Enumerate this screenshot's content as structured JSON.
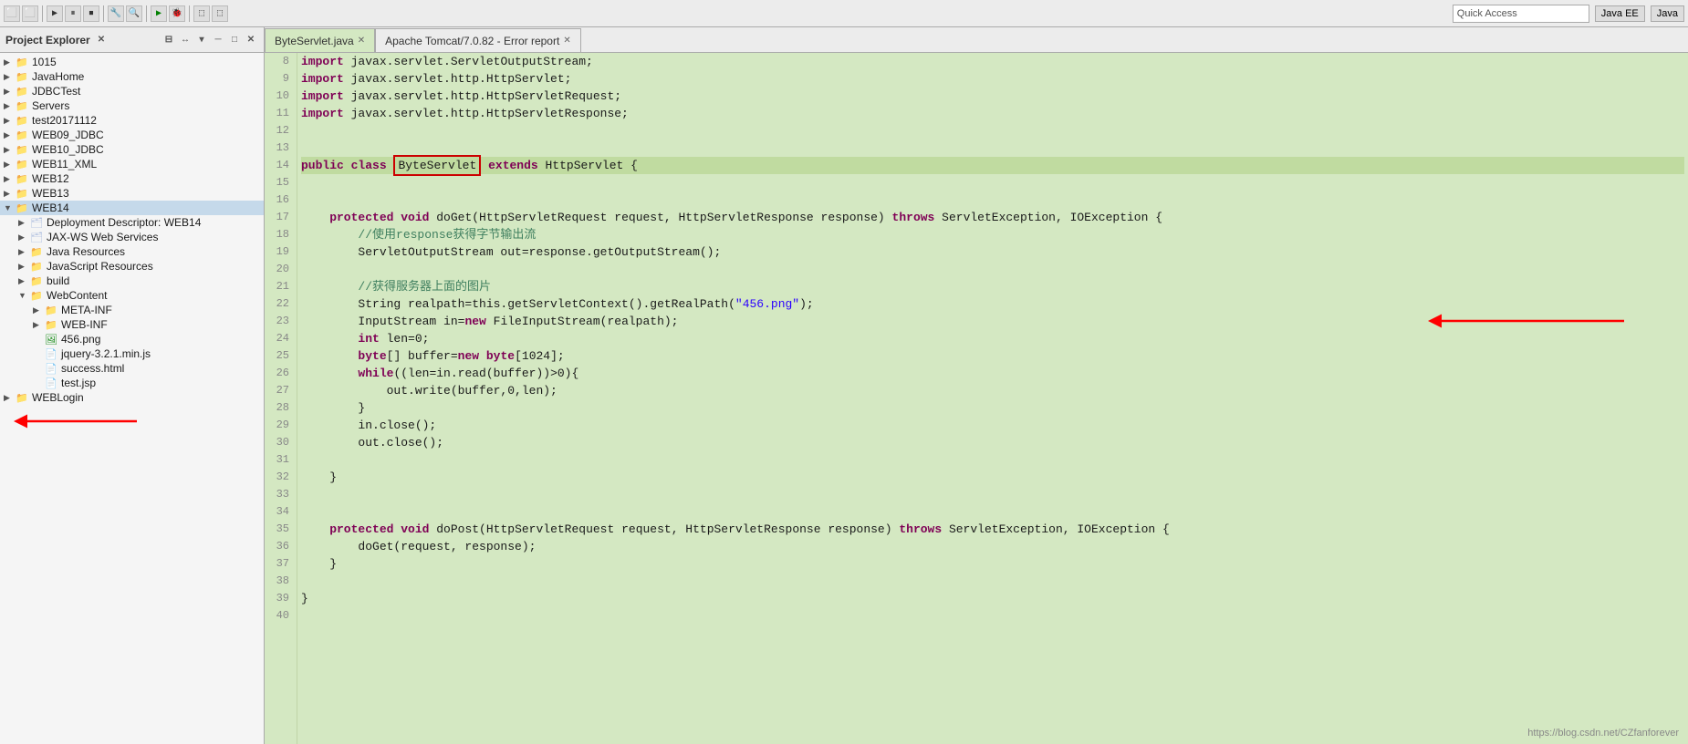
{
  "toolbar": {
    "quick_access_placeholder": "Quick Access",
    "perspective1": "Java EE",
    "perspective2": "Java"
  },
  "left_panel": {
    "title": "Project Explorer",
    "close_icon": "✕",
    "tree_items": [
      {
        "id": "1015",
        "label": "1015",
        "indent": 0,
        "arrow": "▶",
        "type": "project"
      },
      {
        "id": "JavaHome",
        "label": "JavaHome",
        "indent": 0,
        "arrow": "▶",
        "type": "project"
      },
      {
        "id": "JDBCTest",
        "label": "JDBCTest",
        "indent": 0,
        "arrow": "▶",
        "type": "project"
      },
      {
        "id": "Servers",
        "label": "Servers",
        "indent": 0,
        "arrow": "▶",
        "type": "project"
      },
      {
        "id": "test20171112",
        "label": "test20171112",
        "indent": 0,
        "arrow": "▶",
        "type": "project"
      },
      {
        "id": "WEB09_JDBC",
        "label": "WEB09_JDBC",
        "indent": 0,
        "arrow": "▶",
        "type": "project"
      },
      {
        "id": "WEB10_JDBC",
        "label": "WEB10_JDBC",
        "indent": 0,
        "arrow": "▶",
        "type": "project"
      },
      {
        "id": "WEB11_XML",
        "label": "WEB11_XML",
        "indent": 0,
        "arrow": "▶",
        "type": "project"
      },
      {
        "id": "WEB12",
        "label": "WEB12",
        "indent": 0,
        "arrow": "▶",
        "type": "project"
      },
      {
        "id": "WEB13",
        "label": "WEB13",
        "indent": 0,
        "arrow": "▶",
        "type": "project"
      },
      {
        "id": "WEB14",
        "label": "WEB14",
        "indent": 0,
        "arrow": "▼",
        "type": "project",
        "selected": true
      },
      {
        "id": "DeploymentDescriptor",
        "label": "Deployment Descriptor: WEB14",
        "indent": 1,
        "arrow": "▶",
        "type": "xml"
      },
      {
        "id": "JAXWSWebServices",
        "label": "JAX-WS Web Services",
        "indent": 1,
        "arrow": "▶",
        "type": "xml"
      },
      {
        "id": "JavaResources",
        "label": "Java Resources",
        "indent": 1,
        "arrow": "▶",
        "type": "folder"
      },
      {
        "id": "JavaScriptResources",
        "label": "JavaScript Resources",
        "indent": 1,
        "arrow": "▶",
        "type": "folder"
      },
      {
        "id": "build",
        "label": "build",
        "indent": 1,
        "arrow": "▶",
        "type": "folder"
      },
      {
        "id": "WebContent",
        "label": "WebContent",
        "indent": 1,
        "arrow": "▼",
        "type": "folder"
      },
      {
        "id": "META-INF",
        "label": "META-INF",
        "indent": 2,
        "arrow": "▶",
        "type": "folder"
      },
      {
        "id": "WEB-INF",
        "label": "WEB-INF",
        "indent": 2,
        "arrow": "▶",
        "type": "folder"
      },
      {
        "id": "456png",
        "label": "456.png",
        "indent": 2,
        "arrow": "",
        "type": "png"
      },
      {
        "id": "jquery",
        "label": "jquery-3.2.1.min.js",
        "indent": 2,
        "arrow": "",
        "type": "js"
      },
      {
        "id": "successhtml",
        "label": "success.html",
        "indent": 2,
        "arrow": "",
        "type": "html"
      },
      {
        "id": "testjsp",
        "label": "test.jsp",
        "indent": 2,
        "arrow": "",
        "type": "html"
      },
      {
        "id": "WEBLogin",
        "label": "WEBLogin",
        "indent": 0,
        "arrow": "▶",
        "type": "project"
      }
    ]
  },
  "editor": {
    "active_tab": "ByteServlet.java",
    "inactive_tab": "Apache Tomcat/7.0.82 - Error report",
    "lines": [
      {
        "num": 8,
        "content": "import javax.servlet.ServletOutputStream;",
        "tokens": [
          {
            "t": "kw",
            "v": "import"
          },
          {
            "t": "normal",
            "v": " javax.servlet.ServletOutputStream;"
          }
        ]
      },
      {
        "num": 9,
        "content": "import javax.servlet.http.HttpServlet;",
        "tokens": [
          {
            "t": "kw",
            "v": "import"
          },
          {
            "t": "normal",
            "v": " javax.servlet.http.HttpServlet;"
          }
        ]
      },
      {
        "num": 10,
        "content": "import javax.servlet.http.HttpServletRequest;",
        "tokens": [
          {
            "t": "kw",
            "v": "import"
          },
          {
            "t": "normal",
            "v": " javax.servlet.http.HttpServletRequest;"
          }
        ]
      },
      {
        "num": 11,
        "content": "import javax.servlet.http.HttpServletResponse;",
        "tokens": [
          {
            "t": "kw",
            "v": "import"
          },
          {
            "t": "normal",
            "v": " javax.servlet.http.HttpServletResponse;"
          }
        ]
      },
      {
        "num": 12,
        "content": "",
        "tokens": []
      },
      {
        "num": 13,
        "content": "",
        "tokens": []
      },
      {
        "num": 14,
        "content": "public class ByteServlet extends HttpServlet {",
        "tokens": [
          {
            "t": "kw",
            "v": "public"
          },
          {
            "t": "normal",
            "v": " "
          },
          {
            "t": "kw",
            "v": "class"
          },
          {
            "t": "normal",
            "v": " "
          },
          {
            "t": "classname-boxed",
            "v": "ByteServlet"
          },
          {
            "t": "normal",
            "v": " "
          },
          {
            "t": "kw",
            "v": "extends"
          },
          {
            "t": "normal",
            "v": " HttpServlet {"
          }
        ],
        "active": true
      },
      {
        "num": 15,
        "content": "",
        "tokens": []
      },
      {
        "num": 16,
        "content": "",
        "tokens": []
      },
      {
        "num": 17,
        "content": "    protected void doGet(HttpServletRequest request, HttpServletResponse response) throws ServletException, IOException {",
        "tokens": [
          {
            "t": "kw",
            "v": "    protected"
          },
          {
            "t": "normal",
            "v": " "
          },
          {
            "t": "kw",
            "v": "void"
          },
          {
            "t": "normal",
            "v": " doGet(HttpServletRequest request, HttpServletResponse response) "
          },
          {
            "t": "kw",
            "v": "throws"
          },
          {
            "t": "normal",
            "v": " ServletException, IOException {"
          }
        ]
      },
      {
        "num": 18,
        "content": "        //使用response获得字节输出流",
        "tokens": [
          {
            "t": "comment",
            "v": "        //使用response获得字节输出流"
          }
        ]
      },
      {
        "num": 19,
        "content": "        ServletOutputStream out=response.getOutputStream();",
        "tokens": [
          {
            "t": "normal",
            "v": "        ServletOutputStream out=response.getOutputStream();"
          }
        ]
      },
      {
        "num": 20,
        "content": "",
        "tokens": []
      },
      {
        "num": 21,
        "content": "        //获得服务器上面的图片",
        "tokens": [
          {
            "t": "comment",
            "v": "        //获得服务器上面的图片"
          }
        ]
      },
      {
        "num": 22,
        "content": "        String realpath=this.getServletContext().getRealPath(\"456.png\");",
        "tokens": [
          {
            "t": "normal",
            "v": "        String realpath=this.getServletContext().getRealPath("
          },
          {
            "t": "string",
            "v": "\"456.png\""
          },
          {
            "t": "normal",
            "v": ");"
          }
        ]
      },
      {
        "num": 23,
        "content": "        InputStream in=new FileInputStream(realpath);",
        "tokens": [
          {
            "t": "normal",
            "v": "        InputStream in="
          },
          {
            "t": "kw",
            "v": "new"
          },
          {
            "t": "normal",
            "v": " FileInputStream(realpath);"
          }
        ],
        "arrow": true
      },
      {
        "num": 24,
        "content": "        int len=0;",
        "tokens": [
          {
            "t": "normal",
            "v": "        "
          },
          {
            "t": "kw",
            "v": "int"
          },
          {
            "t": "normal",
            "v": " len=0;"
          }
        ]
      },
      {
        "num": 25,
        "content": "        byte[] buffer=new byte[1024];",
        "tokens": [
          {
            "t": "normal",
            "v": "        "
          },
          {
            "t": "kw",
            "v": "byte"
          },
          {
            "t": "normal",
            "v": "[] buffer="
          },
          {
            "t": "kw",
            "v": "new"
          },
          {
            "t": "normal",
            "v": " "
          },
          {
            "t": "kw",
            "v": "byte"
          },
          {
            "t": "normal",
            "v": "[1024];"
          }
        ]
      },
      {
        "num": 26,
        "content": "        while((len=in.read(buffer))>0){",
        "tokens": [
          {
            "t": "normal",
            "v": "        "
          },
          {
            "t": "kw",
            "v": "while"
          },
          {
            "t": "normal",
            "v": "((len=in.read(buffer))>0){"
          }
        ]
      },
      {
        "num": 27,
        "content": "            out.write(buffer,0,len);",
        "tokens": [
          {
            "t": "normal",
            "v": "            out.write(buffer,0,len);"
          }
        ]
      },
      {
        "num": 28,
        "content": "        }",
        "tokens": [
          {
            "t": "normal",
            "v": "        }"
          }
        ]
      },
      {
        "num": 29,
        "content": "        in.close();",
        "tokens": [
          {
            "t": "normal",
            "v": "        in.close();"
          }
        ]
      },
      {
        "num": 30,
        "content": "        out.close();",
        "tokens": [
          {
            "t": "normal",
            "v": "        out.close();"
          }
        ]
      },
      {
        "num": 31,
        "content": "",
        "tokens": []
      },
      {
        "num": 32,
        "content": "    }",
        "tokens": [
          {
            "t": "normal",
            "v": "    }"
          }
        ]
      },
      {
        "num": 33,
        "content": "",
        "tokens": []
      },
      {
        "num": 34,
        "content": "",
        "tokens": []
      },
      {
        "num": 35,
        "content": "    protected void doPost(HttpServletRequest request, HttpServletResponse response) throws ServletException, IOException {",
        "tokens": [
          {
            "t": "kw",
            "v": "    protected"
          },
          {
            "t": "normal",
            "v": " "
          },
          {
            "t": "kw",
            "v": "void"
          },
          {
            "t": "normal",
            "v": " doPost(HttpServletRequest request, HttpServletResponse response) "
          },
          {
            "t": "kw",
            "v": "throws"
          },
          {
            "t": "normal",
            "v": " ServletException, IOException {"
          }
        ]
      },
      {
        "num": 36,
        "content": "        doGet(request, response);",
        "tokens": [
          {
            "t": "normal",
            "v": "        doGet(request, response);"
          }
        ]
      },
      {
        "num": 37,
        "content": "    }",
        "tokens": [
          {
            "t": "normal",
            "v": "    }"
          }
        ]
      },
      {
        "num": 38,
        "content": "",
        "tokens": []
      },
      {
        "num": 39,
        "content": "}",
        "tokens": [
          {
            "t": "normal",
            "v": "}"
          }
        ]
      },
      {
        "num": 40,
        "content": "",
        "tokens": []
      }
    ]
  },
  "watermark": "https://blog.csdn.net/CZfanforever",
  "annotations": {
    "red_box_text": "ByteServlet",
    "arrow_target_line": 23
  }
}
